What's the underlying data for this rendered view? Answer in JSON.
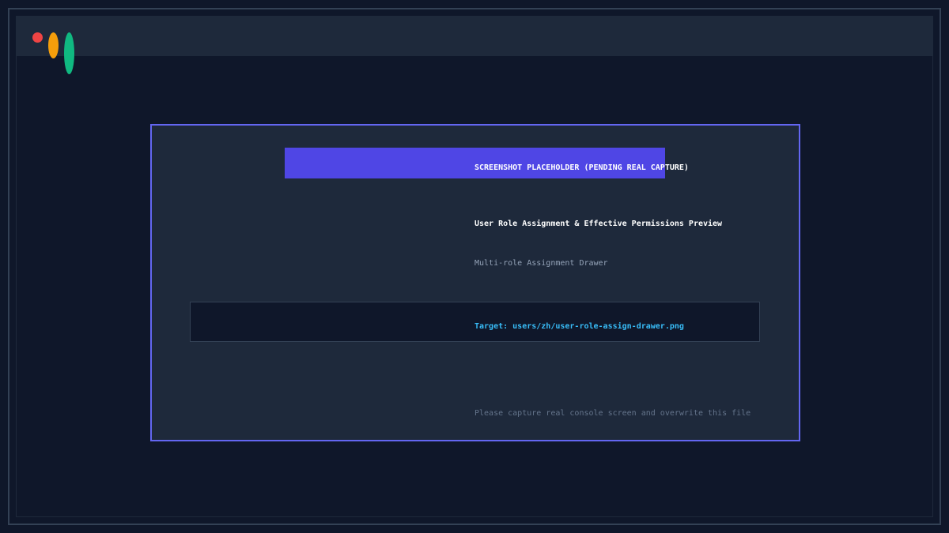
{
  "window": {
    "controls": [
      "close-dot",
      "minimize-dot",
      "maximize-dot"
    ]
  },
  "placeholder": {
    "banner": "SCREENSHOT PLACEHOLDER (PENDING REAL CAPTURE)",
    "title": "User Role Assignment & Effective Permissions Preview",
    "subtitle": "Multi-role Assignment Drawer",
    "target": "Target: users/zh/user-role-assign-drawer.png",
    "footer": "Please capture real console screen and overwrite this file"
  },
  "colors": {
    "background": "#0f172a",
    "panel": "#1e293b",
    "accent": "#6366f1",
    "banner": "#4f46e5",
    "target_text": "#38bdf8",
    "close": "#ef4444",
    "minimize": "#f59e0b",
    "maximize": "#10b981"
  }
}
